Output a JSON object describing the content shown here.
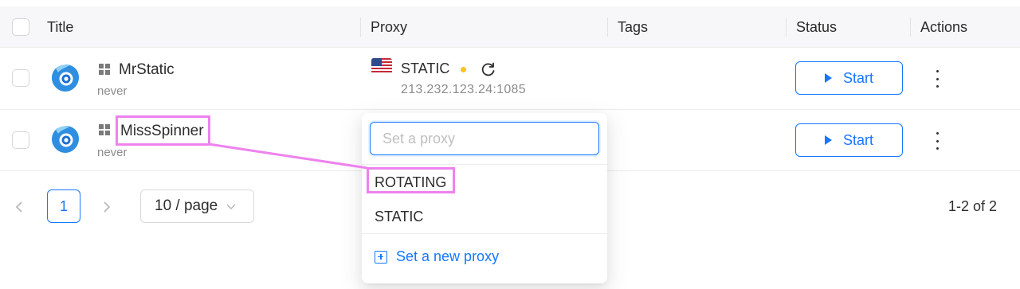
{
  "table": {
    "columns": [
      "Title",
      "Proxy",
      "Tags",
      "Status",
      "Actions"
    ],
    "rows": [
      {
        "title": "MrStatic",
        "last_run": "never",
        "proxy_type": "STATIC",
        "proxy_address": "213.232.123.24:1085",
        "status_button": "Start"
      },
      {
        "title": "MissSpinner",
        "last_run": "never",
        "status_button": "Start"
      }
    ]
  },
  "pagination": {
    "current_page": "1",
    "page_size": "10 / page",
    "total": "1-2 of 2",
    "prev_icon": "chevron-left-icon",
    "next_icon": "chevron-right-icon"
  },
  "proxy_dropdown": {
    "placeholder": "Set a proxy",
    "options": [
      "ROTATING",
      "STATIC"
    ],
    "new_proxy_label": "Set a new proxy"
  },
  "colors": {
    "accent": "#1677ff",
    "highlight": "#ee82ee",
    "status_dot": "#f5c518"
  }
}
